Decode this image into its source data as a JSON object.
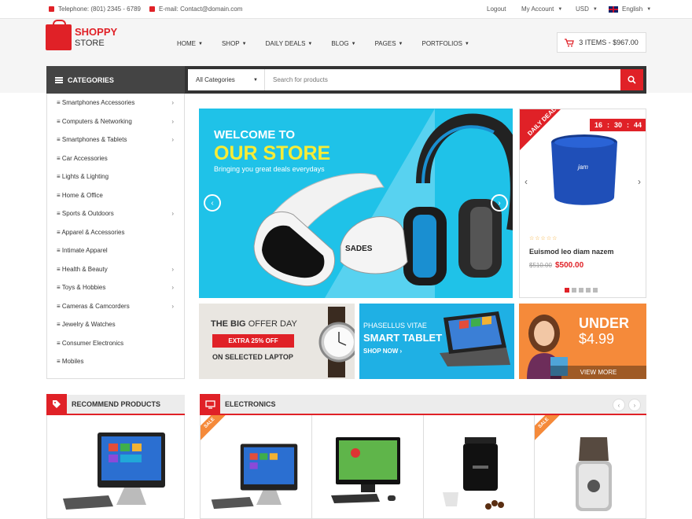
{
  "topbar": {
    "telephone": "Telephone: (801) 2345 - 6789",
    "email": "E-mail: Contact@domain.com",
    "logout": "Logout",
    "my_account": "My Account",
    "currency": "USD",
    "language": "English"
  },
  "logo": {
    "line1": "SHOPPY",
    "line2": "STORE"
  },
  "nav": [
    "HOME",
    "SHOP",
    "DAILY DEALS",
    "BLOG",
    "PAGES",
    "PORTFOLIOS"
  ],
  "cart": {
    "label": "3 ITEMS - $967.00"
  },
  "categories": {
    "title": "CATEGORIES",
    "items": [
      {
        "label": "Smartphones Accessories",
        "has_sub": true
      },
      {
        "label": "Computers & Networking",
        "has_sub": true
      },
      {
        "label": "Smartphones & Tablets",
        "has_sub": true
      },
      {
        "label": "Car Accessories",
        "has_sub": false
      },
      {
        "label": "Lights & Lighting",
        "has_sub": false
      },
      {
        "label": "Home & Office",
        "has_sub": false
      },
      {
        "label": "Sports & Outdoors",
        "has_sub": true
      },
      {
        "label": "Apparel & Accessories",
        "has_sub": false
      },
      {
        "label": "Intimate Apparel",
        "has_sub": false
      },
      {
        "label": "Health & Beauty",
        "has_sub": true
      },
      {
        "label": "Toys & Hobbies",
        "has_sub": true
      },
      {
        "label": "Cameras & Camcorders",
        "has_sub": true
      },
      {
        "label": "Jewelry & Watches",
        "has_sub": false
      },
      {
        "label": "Consumer Electronics",
        "has_sub": false
      },
      {
        "label": "Mobiles",
        "has_sub": false
      }
    ]
  },
  "search": {
    "category": "All Categories",
    "placeholder": "Search for products"
  },
  "slider": {
    "line1": "WELCOME TO",
    "line2": "OUR STORE",
    "line3": "Bringing you great deals everydays",
    "brand": "SADES"
  },
  "deal": {
    "ribbon": "DAILY DEALS",
    "timer": {
      "h": "16",
      "m": "30",
      "s": "44"
    },
    "rating": 0,
    "name": "Euismod leo diam nazem",
    "old_price": "$510.00",
    "new_price": "$500.00",
    "speaker_brand": "jam"
  },
  "banners": {
    "b1": {
      "title_bold": "THE BIG",
      "title_light": "OFFER DAY",
      "offer": "EXTRA 25% OFF",
      "sub": "ON SELECTED LAPTOP"
    },
    "b2": {
      "line1": "PHASELLUS VITAE",
      "line2": "SMART TABLET",
      "cta": "SHOP NOW"
    },
    "b3": {
      "line1": "UNDER",
      "line2": "$4.99",
      "cta": "VIEW MORE"
    }
  },
  "sections": {
    "recommend": "RECOMMEND PRODUCTS",
    "electronics": "ELECTRONICS",
    "sale_label": "SALE"
  },
  "colors": {
    "accent": "#e02127",
    "banner_blue": "#1fb0e4",
    "banner_orange": "#f58a3a",
    "headline_yellow": "#f7ec36"
  }
}
